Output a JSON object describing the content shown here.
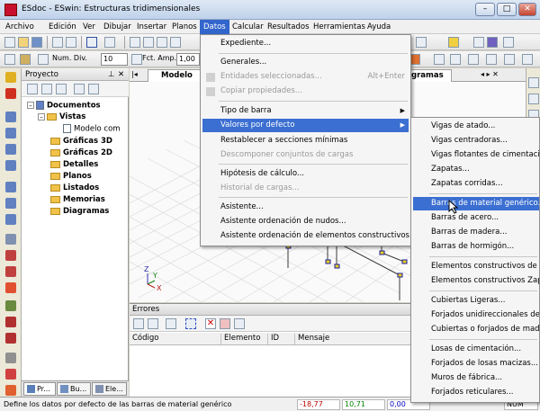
{
  "window": {
    "title": "ESdoc - ESwin: Estructuras tridimensionales",
    "controls": {
      "minimize": "–",
      "maximize": "□",
      "close": "✕"
    }
  },
  "menubar": [
    {
      "label": "Archivo"
    },
    {
      "label": "Edición"
    },
    {
      "label": "Ver"
    },
    {
      "label": "Dibujar"
    },
    {
      "label": "Insertar"
    },
    {
      "label": "Planos"
    },
    {
      "label": "Datos"
    },
    {
      "label": "Calcular"
    },
    {
      "label": "Resultados"
    },
    {
      "label": "Herramientas"
    },
    {
      "label": "Ayuda"
    }
  ],
  "toolbar2": {
    "num_div_label": "Num. Div.",
    "num_div_value": "10",
    "fct_amp_label": "Fct. Amp.",
    "fct_amp_value": "1,00"
  },
  "project_panel": {
    "title": "Proyecto",
    "pin": "⊥",
    "close": "✕",
    "tree": {
      "root": "Documentos",
      "vistas": "Vistas",
      "modelo": "Modelo com",
      "items": [
        "Gráficas 3D",
        "Gráficas 2D",
        "Detalles",
        "Planos",
        "Listados",
        "Memorias",
        "Diagramas"
      ]
    },
    "tabs": [
      "Pr...",
      "Bu...",
      "Ele..."
    ]
  },
  "document_tabs": {
    "first": "Modelo",
    "second": "gramas"
  },
  "errors_panel": {
    "title": "Errores",
    "columns": [
      "Código",
      "Elemento",
      "ID",
      "Mensaje"
    ]
  },
  "datos_menu": {
    "items": [
      {
        "label": "Expediente...",
        "underline": "E"
      },
      {
        "label": "Generales...",
        "underline": "G"
      },
      {
        "label": "Entidades seleccionadas...",
        "disabled": true,
        "shortcut": "Alt+Enter"
      },
      {
        "label": "Copiar propiedades...",
        "disabled": true
      },
      {
        "label": "Tipo de barra",
        "submenu": true
      },
      {
        "label": "Valores por defecto",
        "submenu": true,
        "highlighted": true
      },
      {
        "label": "Restablecer a secciones mínimas"
      },
      {
        "label": "Descomponer conjuntos de cargas",
        "disabled": true
      },
      {
        "label": "Hipótesis de cálculo..."
      },
      {
        "label": "Historial de cargas...",
        "disabled": true
      },
      {
        "label": "Asistente..."
      },
      {
        "label": "Asistente ordenación de nudos..."
      },
      {
        "label": "Asistente ordenación de elementos constructivos..."
      }
    ]
  },
  "defaults_submenu": {
    "items": [
      "Vigas de atado...",
      "Vigas centradoras...",
      "Vigas flotantes de cimentación...",
      "Zapatas...",
      "Zapatas corridas...",
      "Barras de material genérico...",
      "Barras de acero...",
      "Barras de madera...",
      "Barras de hormigón...",
      "Elementos constructivos de horm",
      "Elementos constructivos Zap. co",
      "Cubiertas Ligeras...",
      "Forjados unidireccionales de vig",
      "Cubiertas o forjados de madera...",
      "Losas de cimentación...",
      "Forjados de losas macizas...",
      "Muros de fábrica...",
      "Forjados reticulares..."
    ],
    "highlighted_index": 5
  },
  "statusbar": {
    "message": "Define los datos por defecto de las barras de material genérico",
    "x": "-18,77",
    "y": "10,71",
    "z": "0,00",
    "flags": "NUM"
  },
  "axes": {
    "z": "Z",
    "y": "Y",
    "x": "X"
  },
  "colors": {
    "menu_highlight": "#3b6fd1",
    "status_x": "#c00000",
    "status_y": "#008000",
    "status_z": "#0000c0"
  }
}
